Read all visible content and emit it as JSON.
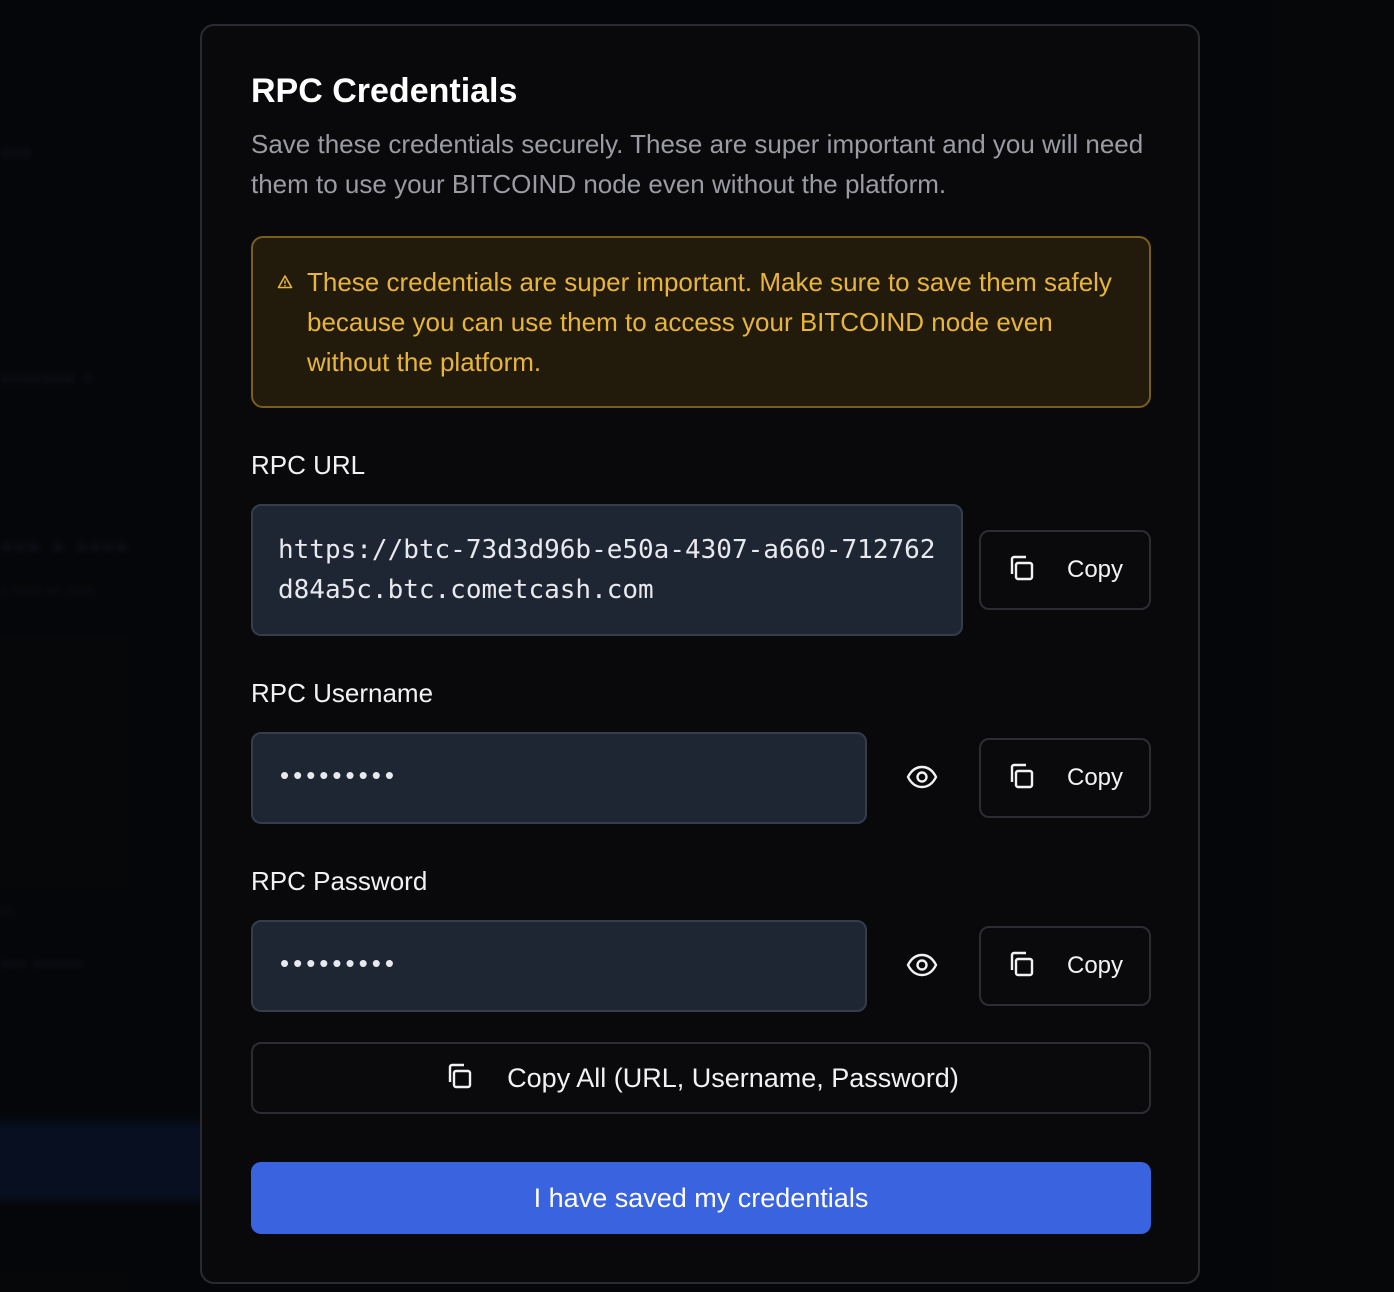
{
  "modal": {
    "title": "RPC Credentials",
    "subtitle": "Save these credentials securely. These are super important and you will need them to use your BITCOIND node even without the platform."
  },
  "warning": {
    "text": "These credentials are super important. Make sure to save them safely because you can use them to access your BITCOIND node even without the platform.",
    "icon": "alert-triangle-icon",
    "color": "#e8b53c"
  },
  "fields": {
    "url": {
      "label": "RPC URL",
      "value": "https://btc-73d3d96b-e50a-4307-a660-712762d84a5c.btc.cometcash.com",
      "copy_label": "Copy"
    },
    "username": {
      "label": "RPC Username",
      "masked_value": "•••••••••",
      "copy_label": "Copy"
    },
    "password": {
      "label": "RPC Password",
      "masked_value": "•••••••••",
      "copy_label": "Copy"
    }
  },
  "actions": {
    "copy_all_label": "Copy All (URL, Username, Password)",
    "confirm_label": "I have saved my credentials"
  },
  "colors": {
    "primary": "#3a63e0",
    "warning_bg": "#221a0b",
    "input_bg": "#1f2633"
  }
}
